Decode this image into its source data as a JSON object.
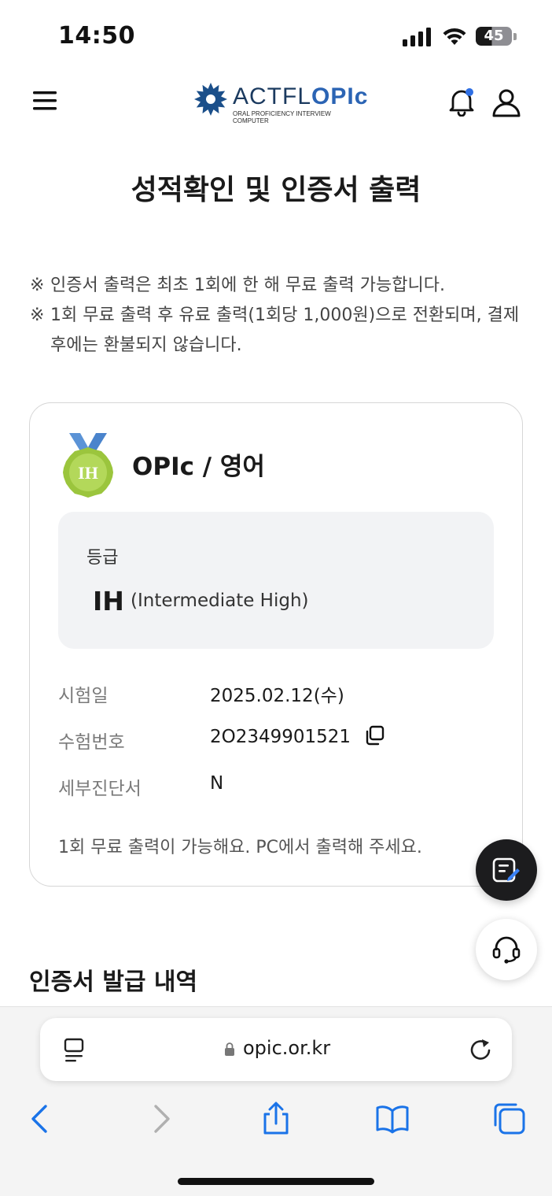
{
  "status_bar": {
    "time": "14:50",
    "battery_level": "45",
    "battery_fraction": 0.45
  },
  "header": {
    "logo_word": "ACTFL",
    "logo_word_accent": "OPIc",
    "logo_sub_1": "ORAL PROFICIENCY INTERVIEW",
    "logo_sub_2": "COMPUTER",
    "notification_dot_color": "#2f6fe4"
  },
  "page": {
    "title": "성적확인 및 인증서 출력",
    "notice_mark": "※",
    "notices": [
      "인증서 출력은 최초 1회에 한 해 무료 출력 가능합니다.",
      "1회 무료 출력 후 유료 출력(1회당 1,000원)으로 전환되며, 결제 후에는 환불되지 않습니다."
    ]
  },
  "result": {
    "medal_text": "IH",
    "exam_name": "OPIc / 영어",
    "grade_label": "등급",
    "grade_code": "IH",
    "grade_desc": "(Intermediate High)",
    "rows": [
      {
        "label": "시험일",
        "value": "2025.02.12(수)"
      },
      {
        "label": "수험번호",
        "value": "2O2349901521"
      },
      {
        "label": "세부진단서",
        "value": "N"
      }
    ],
    "note": "1회 무료 출력이 가능해요. PC에서 출력해 주세요."
  },
  "history": {
    "title": "인증서 발급 내역"
  },
  "browser": {
    "url": "opic.or.kr"
  },
  "colors": {
    "accent_blue": "#2b64b4",
    "medal_green": "#a8cf3c",
    "ribbon_blue": "#5b93d6",
    "safari_blue": "#1a73e8"
  }
}
